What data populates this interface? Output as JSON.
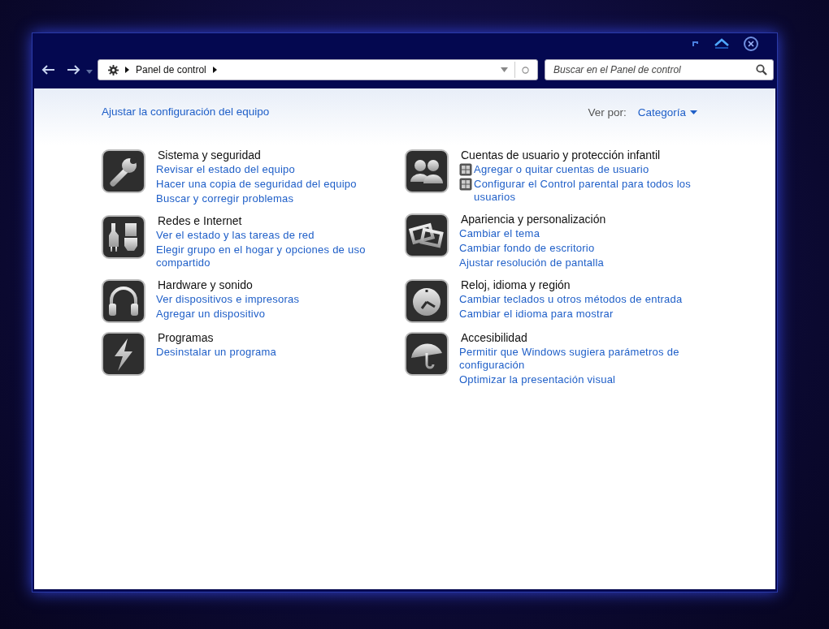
{
  "address_bar": {
    "path": "Panel de control"
  },
  "search": {
    "placeholder": "Buscar en el Panel de control"
  },
  "heading": "Ajustar la configuración del equipo",
  "view_by": {
    "label": "Ver por:",
    "value": "Categoría"
  },
  "columns": [
    {
      "categories": [
        {
          "kind": "wrench",
          "title": "Sistema y seguridad",
          "links": [
            {
              "text": "Revisar el estado del equipo",
              "shield": false
            },
            {
              "text": "Hacer una copia de seguridad del equipo",
              "shield": false
            },
            {
              "text": "Buscar y corregir problemas",
              "shield": false
            }
          ]
        },
        {
          "kind": "plug",
          "title": "Redes e Internet",
          "links": [
            {
              "text": "Ver el estado y las tareas de red",
              "shield": false
            },
            {
              "text": "Elegir grupo en el hogar y opciones de uso compartido",
              "shield": false
            }
          ]
        },
        {
          "kind": "headphones",
          "title": "Hardware y sonido",
          "links": [
            {
              "text": "Ver dispositivos e impresoras",
              "shield": false
            },
            {
              "text": "Agregar un dispositivo",
              "shield": false
            }
          ]
        },
        {
          "kind": "bolt",
          "title": "Programas",
          "links": [
            {
              "text": "Desinstalar un programa",
              "shield": false
            }
          ]
        }
      ]
    },
    {
      "categories": [
        {
          "kind": "users",
          "title": "Cuentas de usuario y protección infantil",
          "links": [
            {
              "text": "Agregar o quitar cuentas de usuario",
              "shield": true
            },
            {
              "text": "Configurar el Control parental para todos los usuarios",
              "shield": true
            }
          ]
        },
        {
          "kind": "photos",
          "title": "Apariencia y personalización",
          "links": [
            {
              "text": "Cambiar el tema",
              "shield": false
            },
            {
              "text": "Cambiar fondo de escritorio",
              "shield": false
            },
            {
              "text": "Ajustar resolución de pantalla",
              "shield": false
            }
          ]
        },
        {
          "kind": "clock",
          "title": "Reloj, idioma y región",
          "links": [
            {
              "text": "Cambiar teclados u otros métodos de entrada",
              "shield": false
            },
            {
              "text": "Cambiar el idioma para mostrar",
              "shield": false
            }
          ]
        },
        {
          "kind": "umbrella",
          "title": "Accesibilidad",
          "links": [
            {
              "text": "Permitir que Windows sugiera parámetros de configuración",
              "shield": false
            },
            {
              "text": "Optimizar la presentación visual",
              "shield": false
            }
          ]
        }
      ]
    }
  ]
}
